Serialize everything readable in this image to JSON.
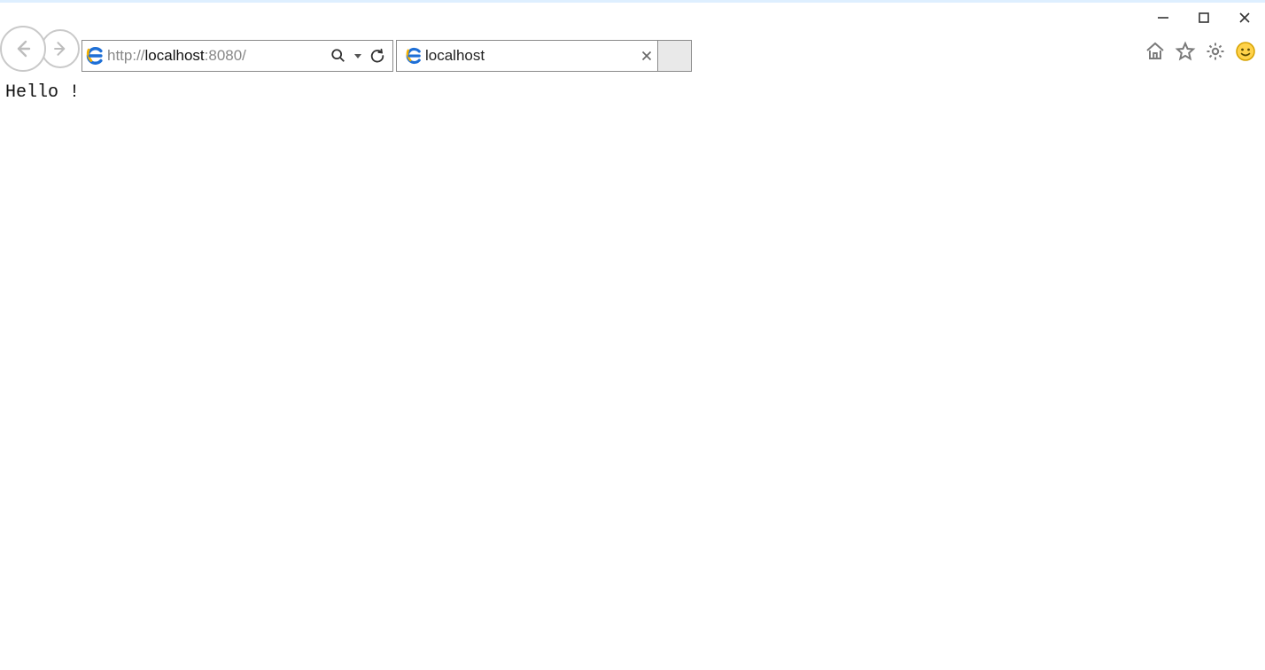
{
  "addressbar": {
    "url_full": "http://localhost:8080/",
    "url_protocol": "http://",
    "url_host": "localhost",
    "url_port_path": ":8080/"
  },
  "tab": {
    "title": "localhost"
  },
  "page": {
    "body_text": "Hello !"
  },
  "icons": {
    "back": "back-arrow",
    "forward": "forward-arrow",
    "ie": "internet-explorer",
    "search": "magnifier",
    "dropdown": "caret-down",
    "refresh": "refresh",
    "close_tab": "×",
    "home": "home",
    "favorites": "star",
    "tools": "gear",
    "smiley": "smiley",
    "win_min": "minimize",
    "win_max": "maximize",
    "win_close": "close"
  },
  "colors": {
    "border": "#8a8a8a",
    "nav_border": "#c9c9c9",
    "ie_blue": "#1e6fd6",
    "ie_gold": "#f5b100",
    "toolbar_gray": "#7a7a7a",
    "smiley_fill": "#ffd24a",
    "smiley_stroke": "#d6a200"
  }
}
